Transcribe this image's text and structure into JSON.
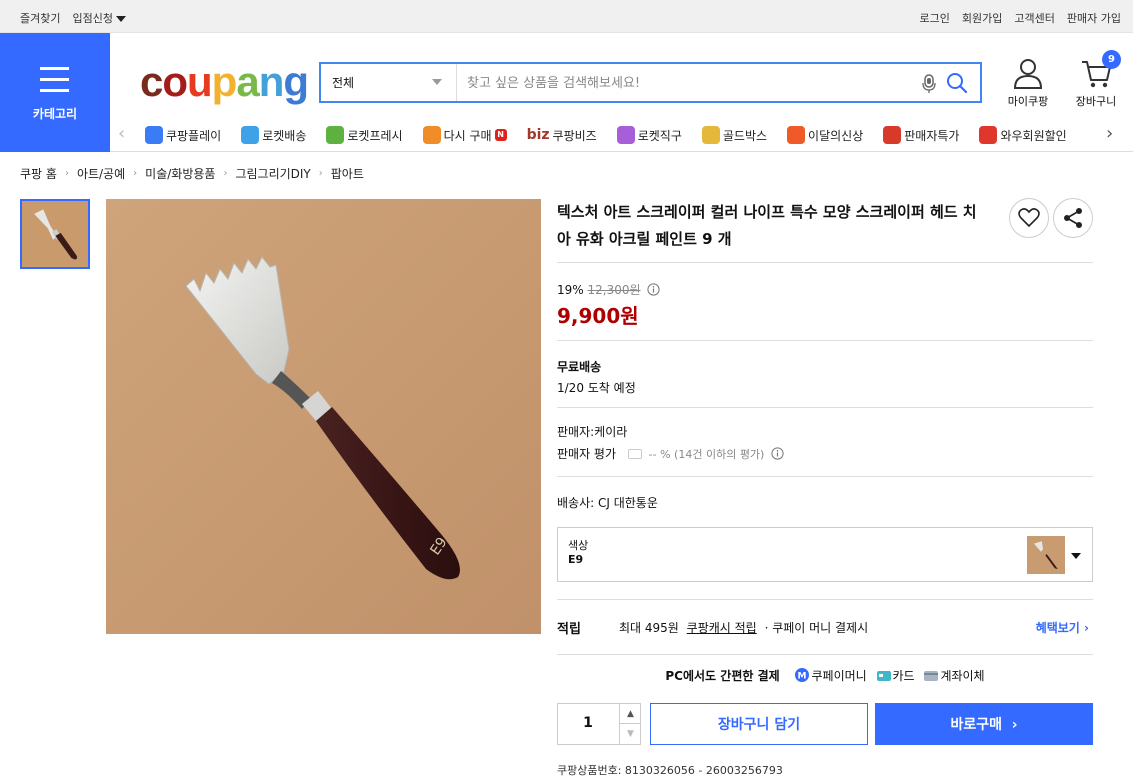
{
  "topbar": {
    "left": [
      "즐겨찾기",
      "입점신청"
    ],
    "right": [
      "로그인",
      "회원가입",
      "고객센터",
      "판매자 가입"
    ]
  },
  "category_label": "카테고리",
  "logo": {
    "letters": [
      "c",
      "o",
      "u",
      "p",
      "a",
      "n",
      "g"
    ],
    "colors": [
      "#7a2a1c",
      "#a41d1a",
      "#e63b20",
      "#f2b12f",
      "#79b94a",
      "#42a1d6",
      "#3d7bd5"
    ]
  },
  "search": {
    "category": "전체",
    "placeholder": "찾고 싶은 상품을 검색해보세요!"
  },
  "header": {
    "mycoupang": "마이쿠팡",
    "cart": "장바구니",
    "cart_count": "9"
  },
  "nav": {
    "items": [
      {
        "label": "쿠팡플레이",
        "icon": "play-icon",
        "color": "#3b7bf5"
      },
      {
        "label": "로켓배송",
        "icon": "rocket-icon",
        "color": "#3fa1e8"
      },
      {
        "label": "로켓프레시",
        "icon": "fresh-rocket-icon",
        "color": "#5db23f"
      },
      {
        "label": "다시 구매",
        "icon": "basket-icon",
        "color": "#f08d28",
        "badge": "N"
      },
      {
        "label": "쿠팡비즈",
        "icon": "biz-icon",
        "color": "#a13a2b",
        "prefix": "biz"
      },
      {
        "label": "로켓직구",
        "icon": "globe-icon",
        "color": "#a65fd8"
      },
      {
        "label": "골드박스",
        "icon": "goldbox-icon",
        "color": "#e5b73b"
      },
      {
        "label": "이달의신상",
        "icon": "new-bag-icon",
        "color": "#f05a28"
      },
      {
        "label": "판매자특가",
        "icon": "percent-icon",
        "color": "#d83a2a"
      },
      {
        "label": "와우회원할인",
        "icon": "wow-icon",
        "color": "#e0372c"
      }
    ]
  },
  "breadcrumb": [
    "쿠팡 홈",
    "아트/공예",
    "미술/화방용품",
    "그림그리기DIY",
    "팝아트"
  ],
  "product": {
    "title": "텍스처 아트 스크레이퍼 컬러 나이프 특수 모양 스크레이퍼 헤드 치아 유화 아크릴 페인트 9 개",
    "discount_rate": "19%",
    "original_price": "12,300원",
    "price": "9,900원",
    "shipping_title": "무료배송",
    "arrival": "1/20 도착 예정",
    "seller": "판매자:케이라",
    "seller_rating_label": "판매자 평가",
    "seller_rating_value": "-- % (14건 이하의 평가)",
    "courier": "배송사:  CJ 대한통운",
    "option_label": "색상",
    "option_value": "E9",
    "knife_engraving": "E9"
  },
  "points": {
    "label": "적립",
    "text1": "최대 495원",
    "link": "쿠팡캐시 적립",
    "text2": "· 쿠페이 머니 결제시",
    "more": "혜택보기"
  },
  "pay": {
    "title": "PC에서도 간편한 결제",
    "methods": [
      "쿠페이머니",
      "카드",
      "계좌이체"
    ]
  },
  "purchase": {
    "quantity": "1",
    "add_cart": "장바구니 담기",
    "buy_now": "바로구매"
  },
  "product_code": "쿠팡상품번호: 8130326056 - 26003256793"
}
